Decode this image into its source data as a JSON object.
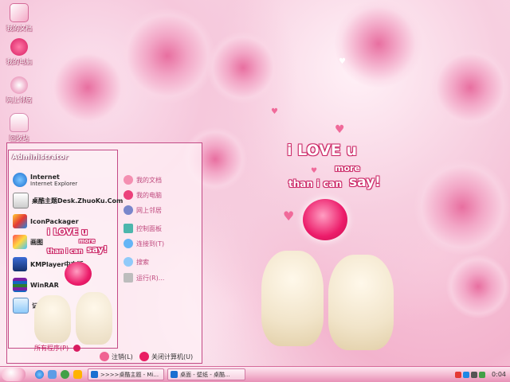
{
  "desktop": {
    "icons": [
      {
        "label": "我的文档",
        "icon": "my-documents-icon"
      },
      {
        "label": "我的电脑",
        "icon": "my-computer-icon"
      },
      {
        "label": "网上邻居",
        "icon": "network-icon"
      },
      {
        "label": "回收站",
        "icon": "recycle-bin-icon"
      }
    ]
  },
  "wallpaper": {
    "line1": "i LOVE u",
    "line2": "more",
    "line3": "than i can",
    "line4": "say!"
  },
  "start_menu": {
    "user": "Administrator",
    "programs": [
      {
        "title": "Internet",
        "subtitle": "Internet Explorer",
        "icon": "ie-icon"
      },
      {
        "title": "桌酷主题Desk.ZhuoKu.Com",
        "subtitle": "",
        "icon": "theme-icon"
      },
      {
        "title": "IconPackager",
        "subtitle": "",
        "icon": "iconpackager-icon"
      },
      {
        "title": "画图",
        "subtitle": "",
        "icon": "paint-icon"
      },
      {
        "title": "KMPlayer中文版",
        "subtitle": "",
        "icon": "kmplayer-icon"
      },
      {
        "title": "WinRAR",
        "subtitle": "",
        "icon": "winrar-icon"
      },
      {
        "title": "记事本",
        "subtitle": "",
        "icon": "notepad-icon"
      }
    ],
    "places": [
      {
        "label": "我的文档",
        "icon": "my-documents-icon"
      },
      {
        "label": "我的电脑",
        "icon": "my-computer-icon"
      },
      {
        "label": "网上邻居",
        "icon": "network-icon"
      },
      {
        "label": "控制面板",
        "icon": "control-panel-icon"
      },
      {
        "label": "连接到(T)",
        "icon": "connect-icon"
      },
      {
        "label": "搜索",
        "icon": "search-icon"
      },
      {
        "label": "运行(R)...",
        "icon": "run-icon"
      }
    ],
    "all_programs": "所有程序(P)",
    "logoff": "注销(L)",
    "shutdown": "关闭计算机(U)"
  },
  "taskbar": {
    "tasks": [
      {
        "label": ">>>>桌酷主题 - Mi...",
        "icon": "ie-icon"
      },
      {
        "label": "桌面 - 壁纸 - 桌酷...",
        "icon": "ie-icon"
      }
    ],
    "clock": "0:04"
  },
  "colors": {
    "accent": "#c2185b",
    "menu_border": "#c34b86",
    "taskbar": "#f3b8d0"
  }
}
